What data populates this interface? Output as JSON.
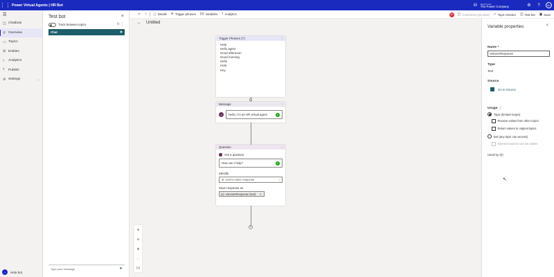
{
  "appbar": {
    "title": "Power Virtual Agents | HR Bot",
    "env_label": "Environment",
    "env_value": "The Power Company",
    "user_initials": "AU",
    "env_icon": "environment-icon",
    "settings_icon": "gear-icon",
    "help_icon": "help-icon",
    "brand_color": "#1a2abf"
  },
  "nav": {
    "items": [
      {
        "label": "Chatbots",
        "icon": "chatbot-icon"
      },
      {
        "label": "Overview",
        "icon": "overview-icon"
      },
      {
        "label": "Topics",
        "icon": "topics-icon"
      },
      {
        "label": "Entities",
        "icon": "entities-icon"
      },
      {
        "label": "Analytics",
        "icon": "analytics-icon"
      },
      {
        "label": "Publish",
        "icon": "publish-icon"
      },
      {
        "label": "Settings",
        "icon": "settings-icon"
      }
    ],
    "hide_bot": "Hide bot"
  },
  "testbot": {
    "title": "Test bot",
    "track_label": "Track between topics",
    "chat_label": "Chat",
    "input_placeholder": "Type your message"
  },
  "toolbar": {
    "details": "Details",
    "trigger_phrases": "Trigger phrases",
    "variables": "Variables",
    "analytics": "Analytics",
    "error_count": "40",
    "comments": "Comments (preview)",
    "topic_checker": "Topic checker",
    "test_bot": "Test bot",
    "save": "Save"
  },
  "canvas": {
    "breadcrumb": "Untitled",
    "trigger": {
      "header": "Trigger Phrases (7)",
      "phrases": [
        "Help",
        "Hello agent",
        "Good afternoon",
        "Good morning",
        "Hello",
        "Hola",
        "Hey"
      ]
    },
    "message": {
      "header": "Message",
      "text": "Hello, I'm an HR virtual agent"
    },
    "question": {
      "header": "Question",
      "ask_label": "Ask a question",
      "question_text": "How can I help?",
      "identify_label": "Identify",
      "identify_value": "User's entire response",
      "save_label": "Save response as",
      "variable": "VarUserResponse (text)"
    }
  },
  "props": {
    "title": "Variable properties",
    "name_label": "Name",
    "name_value": "VarUserResponse",
    "type_label": "Type",
    "type_value": "Text",
    "source_label": "Source",
    "source_link": "Go to Source",
    "usage_label": "Usage",
    "topic_scope": "Topic (limited scope)",
    "receive_values": "Receive values from other topics",
    "return_values": "Return values to original topics",
    "bot_scope": "Bot (any topic can access)",
    "external_sources": "External sources can set values",
    "used_by": "Used by (0)"
  }
}
